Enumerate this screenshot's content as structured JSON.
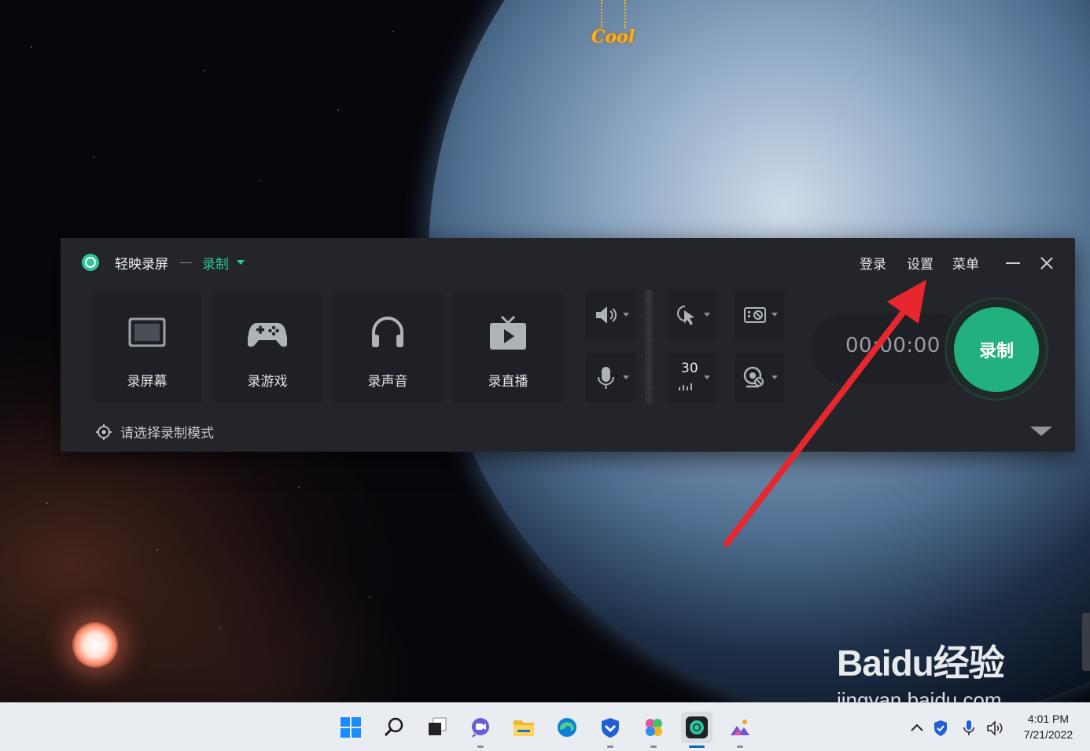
{
  "desktop": {
    "wallpaper_tag": "Cool"
  },
  "app": {
    "title": "轻映录屏",
    "mode_selected": "录制",
    "top_links": {
      "login": "登录",
      "settings": "设置",
      "menu": "菜单"
    },
    "modes": [
      {
        "label": "录屏幕",
        "icon": "screen-icon"
      },
      {
        "label": "录游戏",
        "icon": "gamepad-icon"
      },
      {
        "label": "录声音",
        "icon": "headphones-icon"
      },
      {
        "label": "录直播",
        "icon": "tv-play-icon"
      }
    ],
    "controls": {
      "fps": "30"
    },
    "timer": "00:00:00",
    "record_label": "录制",
    "hint": "请选择录制模式",
    "accent": "#2ec59a"
  },
  "annotation": {
    "arrow_color": "#e8262d"
  },
  "watermark": {
    "brand": "Baidu经验",
    "url": "jingyan.baidu.com"
  },
  "taskbar": {
    "apps": [
      "start-icon",
      "search-icon",
      "task-view-icon",
      "chat-icon",
      "file-explorer-icon",
      "edge-icon",
      "security-shield-icon",
      "photos-pinwheel-icon",
      "screen-recorder-icon",
      "photos-mountain-icon"
    ],
    "clock_time": "4:01 PM",
    "clock_date": "7/21/2022"
  }
}
